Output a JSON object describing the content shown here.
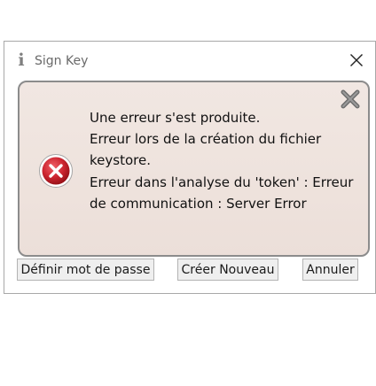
{
  "window": {
    "title": "Sign Key",
    "title_icon": "info-icon"
  },
  "message": {
    "lines": [
      "Une erreur s'est produite.",
      "Erreur lors de la création du fichier",
      "keystore.",
      "Erreur dans l'analyse du 'token' : Erreur",
      "de communication : Server Error"
    ],
    "icon": "error-icon"
  },
  "buttons": {
    "define_password": "Définir mot de passe",
    "create_new": "Créer Nouveau",
    "cancel": "Annuler"
  },
  "colors": {
    "error_red": "#c8242f",
    "panel_background": "#efe4de",
    "panel_border": "#8c8c8c",
    "button_background": "#efefef"
  }
}
